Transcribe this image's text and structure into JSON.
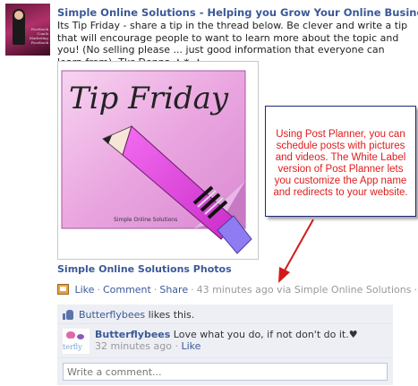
{
  "post": {
    "author": "Simple Online Solutions - Helping you Grow Your Online Business",
    "text": "Its Tip Friday - share a tip in the thread below. Be clever and write a tip that will encourage people to want to learn more about the topic and you! (No selling please ... just good information that everyone can learn from). Tks Donna ★✷ ★",
    "avatar_text": "Facebook Coach Marketing Facebook"
  },
  "photo": {
    "title_lettering": "Tip Friday",
    "watermark": "Simple Online Solutions",
    "caption": "Simple Online Solutions Photos"
  },
  "annotation": {
    "text": "Using Post Planner, you can schedule posts with pictures and videos. The White Label version of Post Planner lets you customize the App name and redirects to your website.",
    "color": "#e01b1b"
  },
  "actions": {
    "like": "Like",
    "comment": "Comment",
    "share": "Share",
    "time": "43 minutes ago via",
    "via_app": "Simple Online Solutions"
  },
  "likes": {
    "name": "Butterflybees",
    "suffix": " likes this."
  },
  "comment": {
    "author": "Butterflybees",
    "text": "Love what you do, if not don't do it.♥",
    "time": "32 minutes ago",
    "like": "Like",
    "avatar_text": "terfly"
  },
  "write_comment": {
    "placeholder": "Write a comment..."
  },
  "colors": {
    "link": "#3b5998",
    "feedback_bg": "#edeff4"
  }
}
